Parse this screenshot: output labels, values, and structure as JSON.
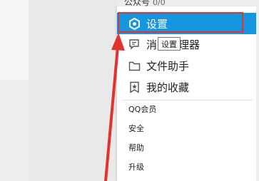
{
  "background": {
    "partial_item_label": "公众号",
    "partial_item_count": "0/0"
  },
  "menu": {
    "items": [
      {
        "label": "设置",
        "icon": "settings-hex-icon",
        "active": true
      },
      {
        "label": "消息管理器",
        "icon": "message-icon"
      },
      {
        "label": "文件助手",
        "icon": "folder-icon"
      },
      {
        "label": "我的收藏",
        "icon": "bookmark-icon"
      }
    ],
    "small_items": [
      {
        "label": "QQ会员"
      },
      {
        "label": "安全"
      },
      {
        "label": "帮助"
      },
      {
        "label": "升级"
      }
    ]
  },
  "tooltip": "设置",
  "colors": {
    "active": "#1696de",
    "annotation": "#e0322f"
  }
}
